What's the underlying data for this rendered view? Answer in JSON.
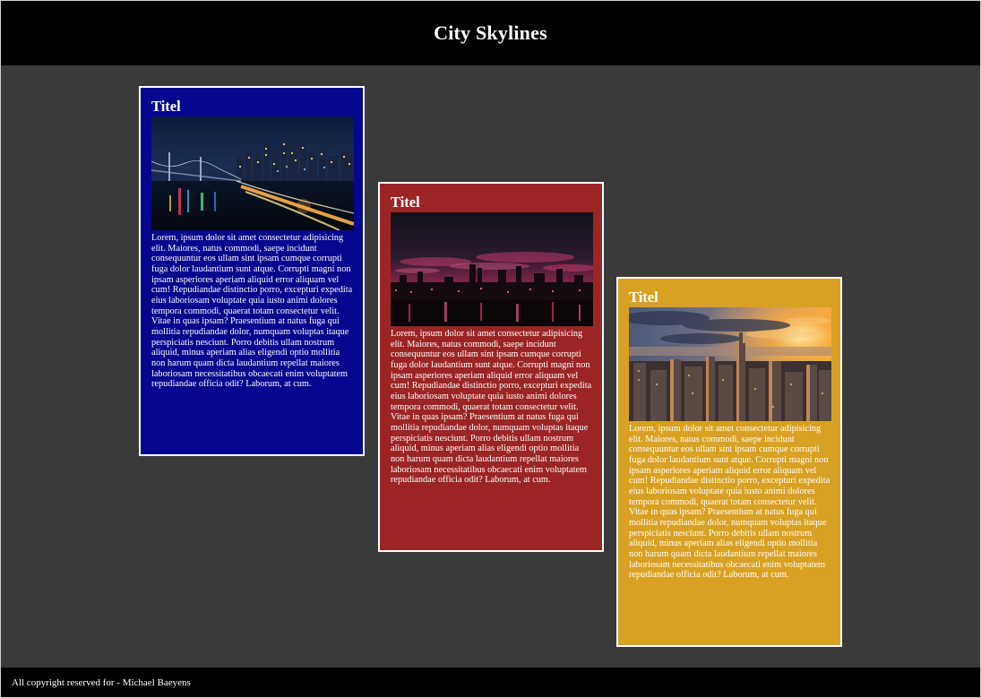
{
  "header": {
    "title": "City Skylines"
  },
  "cards": [
    {
      "title": "Titel",
      "color": "#06068e",
      "image": "night-city-bridge-photo",
      "text": "Lorem, ipsum dolor sit amet consectetur adipisicing elit. Maiores, natus commodi, saepe incidunt consequuntur eos ullam sint ipsam cumque corrupti fuga dolor laudantium sunt atque. Corrupti magni non ipsam asperiores aperiam aliquid error aliquam vel cum! Repudiandae distinctio porro, excepturi expedita eius laboriosam voluptate quia iusto animi dolores tempora commodi, quaerat totam consectetur velit. Vitae in quas ipsam? Praesentium at natus fuga qui mollitia repudiandae dolor, numquam voluptas itaque perspiciatis nesciunt. Porro debitis ullam nostrum aliquid, minus aperiam alias eligendi optio mollitia non harum quam dicta laudantium repellat maiores laboriosam necessitatibus obcaecati enim voluptatem repudiandae officia odit? Laborum, at cum."
    },
    {
      "title": "Titel",
      "color": "#9b2525",
      "image": "red-dusk-skyline-photo",
      "text": "Lorem, ipsum dolor sit amet consectetur adipisicing elit. Maiores, natus commodi, saepe incidunt consequuntur eos ullam sint ipsam cumque corrupti fuga dolor laudantium sunt atque. Corrupti magni non ipsam asperiores aperiam aliquid error aliquam vel cum! Repudiandae distinctio porro, excepturi expedita eius laboriosam voluptate quia iusto animi dolores tempora commodi, quaerat totam consectetur velit. Vitae in quas ipsam? Praesentium at natus fuga qui mollitia repudiandae dolor, numquam voluptas itaque perspiciatis nesciunt. Porro debitis ullam nostrum aliquid, minus aperiam alias eligendi optio mollitia non harum quam dicta laudantium repellat maiores laboriosam necessitatibus obcaecati enim voluptatem repudiandae officia odit? Laborum, at cum."
    },
    {
      "title": "Titel",
      "color": "#d8a123",
      "image": "sunset-manhattan-aerial-photo",
      "text": "Lorem, ipsum dolor sit amet consectetur adipisicing elit. Maiores, natus commodi, saepe incidunt consequuntur eos ullam sint ipsam cumque corrupti fuga dolor laudantium sunt atque. Corrupti magni non ipsam asperiores aperiam aliquid error aliquam vel cum! Repudiandae distinctio porro, excepturi expedita eius laboriosam voluptate quia iusto animi dolores tempora commodi, quaerat totam consectetur velit. Vitae in quas ipsam? Praesentium at natus fuga qui mollitia repudiandae dolor, numquam voluptas itaque perspiciatis nesciunt. Porro debitis ullam nostrum aliquid, minus aperiam alias eligendi optio mollitia non harum quam dicta laudantium repellat maiores laboriosam necessitatibus obcaecati enim voluptatem repudiandae officia odit? Laborum, at cum."
    }
  ],
  "footer": {
    "text": "All copyright reserved for - Michael Baeyens"
  },
  "colors": {
    "background": "#3a3a3a",
    "bar": "#000000",
    "card_border": "#ffffff"
  }
}
